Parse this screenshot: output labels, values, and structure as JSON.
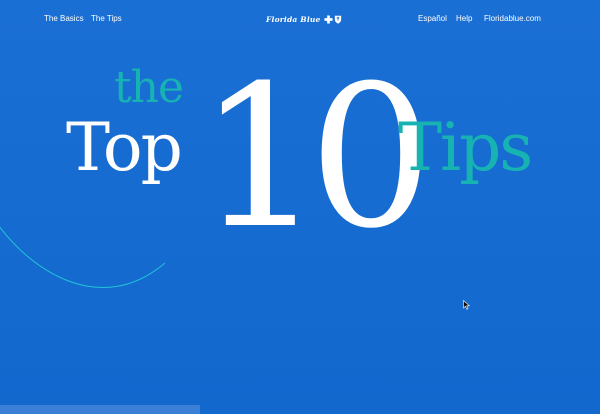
{
  "nav": {
    "left_links": [
      "The Basics",
      "The Tips"
    ],
    "logo_text": "Florida Blue",
    "logo_icons": [
      "cross-icon",
      "shield-icon"
    ],
    "right_links": [
      "Español",
      "Help",
      "Floridablue.com"
    ]
  },
  "hero": {
    "the": "the",
    "top": "Top",
    "number": "10",
    "tips": "Tips"
  },
  "colors": {
    "background": "#1267cf",
    "teal": "#17b3b3",
    "white": "#ffffff"
  }
}
